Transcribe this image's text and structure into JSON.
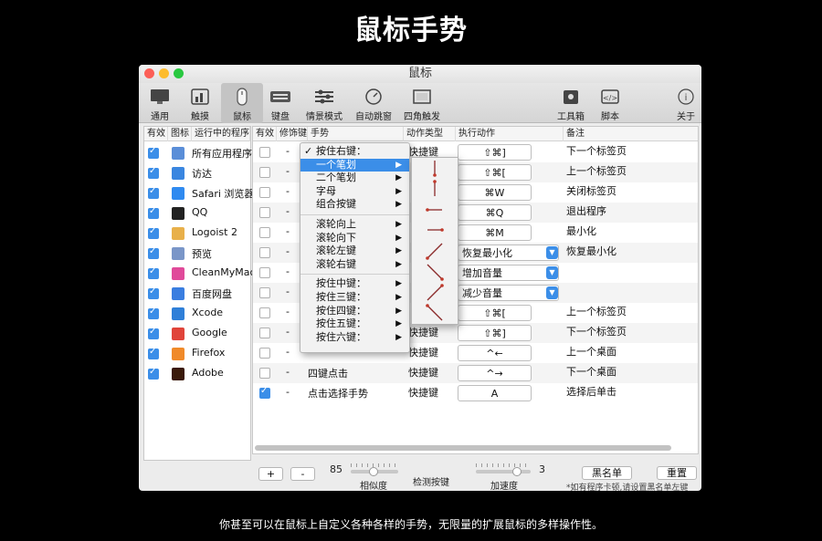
{
  "page_title": "鼠标手势",
  "caption": "你甚至可以在鼠标上自定义各种各样的手势，无限量的扩展鼠标的多样操作性。",
  "window": {
    "title": "鼠标",
    "toolbar": [
      {
        "label": "通用",
        "icon": "display-icon"
      },
      {
        "label": "触摸",
        "icon": "chart-icon"
      },
      {
        "label": "鼠标",
        "icon": "mouse-icon"
      },
      {
        "label": "键盘",
        "icon": "keyboard-icon"
      },
      {
        "label": "情景模式",
        "icon": "sliders-icon"
      },
      {
        "label": "自动跳窗",
        "icon": "speedometer-icon"
      },
      {
        "label": "四角触发",
        "icon": "corners-icon"
      },
      {
        "label": "工具箱",
        "icon": "toolbox-icon"
      },
      {
        "label": "脚本",
        "icon": "script-icon"
      },
      {
        "label": "关于",
        "icon": "info-icon"
      }
    ],
    "left_table": {
      "headers": [
        "有效",
        "图标",
        "运行中的程序"
      ],
      "rows": [
        {
          "name": "所有应用程序",
          "color": "#5a8ed8",
          "checked": true
        },
        {
          "name": "访达",
          "color": "#3a86e0",
          "checked": true
        },
        {
          "name": "Safari 浏览器",
          "color": "#2f8af0",
          "checked": true
        },
        {
          "name": "QQ",
          "color": "#222222",
          "checked": true
        },
        {
          "name": "Logoist 2",
          "color": "#e8b04a",
          "checked": true
        },
        {
          "name": "预览",
          "color": "#7a96c8",
          "checked": true
        },
        {
          "name": "CleanMyMac",
          "color": "#e04a9a",
          "checked": true
        },
        {
          "name": "百度网盘",
          "color": "#3a7ee0",
          "checked": true
        },
        {
          "name": "Xcode",
          "color": "#2f7fd8",
          "checked": true
        },
        {
          "name": "Google",
          "color": "#e0443a",
          "checked": true
        },
        {
          "name": "Firefox",
          "color": "#f08a2a",
          "checked": true
        },
        {
          "name": "Adobe",
          "color": "#3a1a0a",
          "checked": true
        }
      ]
    },
    "right_table": {
      "headers": [
        "有效",
        "修饰键",
        "手势",
        "动作类型",
        "执行动作",
        "备注"
      ],
      "rows": [
        {
          "checked": false,
          "mod": "-",
          "gesture": "",
          "type": "快捷键",
          "action": "⇧⌘]",
          "select": false,
          "note": "下一个标签页"
        },
        {
          "checked": false,
          "mod": "-",
          "gesture": "",
          "type": "",
          "action": "⇧⌘[",
          "select": false,
          "note": "上一个标签页"
        },
        {
          "checked": false,
          "mod": "-",
          "gesture": "",
          "type": "",
          "action": "⌘W",
          "select": false,
          "note": "关闭标签页"
        },
        {
          "checked": false,
          "mod": "-",
          "gesture": "",
          "type": "",
          "action": "⌘Q",
          "select": false,
          "note": "退出程序"
        },
        {
          "checked": false,
          "mod": "-",
          "gesture": "",
          "type": "",
          "action": "⌘M",
          "select": false,
          "note": "最小化"
        },
        {
          "checked": false,
          "mod": "-",
          "gesture": "",
          "type": "",
          "action": "恢复最小化",
          "select": true,
          "note": "恢复最小化"
        },
        {
          "checked": false,
          "mod": "-",
          "gesture": "",
          "type": "",
          "action": "增加音量",
          "select": true,
          "note": ""
        },
        {
          "checked": false,
          "mod": "-",
          "gesture": "",
          "type": "",
          "action": "减少音量",
          "select": true,
          "note": ""
        },
        {
          "checked": false,
          "mod": "-",
          "gesture": "",
          "type": "",
          "action": "⇧⌘[",
          "select": false,
          "note": "上一个标签页"
        },
        {
          "checked": false,
          "mod": "-",
          "gesture": "",
          "type": "快捷键",
          "action": "⇧⌘]",
          "select": false,
          "note": "下一个标签页"
        },
        {
          "checked": false,
          "mod": "-",
          "gesture": "",
          "type": "快捷键",
          "action": "^←",
          "select": false,
          "note": "上一个桌面"
        },
        {
          "checked": false,
          "mod": "-",
          "gesture": "四键点击",
          "type": "快捷键",
          "action": "^→",
          "select": false,
          "note": "下一个桌面"
        },
        {
          "checked": true,
          "mod": "-",
          "gesture": "点击选择手势",
          "type": "快捷键",
          "action": "A",
          "select": false,
          "note": "选择后单击"
        }
      ]
    },
    "context_menu": {
      "items": [
        {
          "label": "按住右键：",
          "checked": true,
          "submenu": false,
          "highlighted": false
        },
        {
          "label": "一个笔划",
          "checked": false,
          "submenu": true,
          "highlighted": true
        },
        {
          "label": "二个笔划",
          "checked": false,
          "submenu": true,
          "highlighted": false
        },
        {
          "label": "字母",
          "checked": false,
          "submenu": true,
          "highlighted": false
        },
        {
          "label": "组合按键",
          "checked": false,
          "submenu": true,
          "highlighted": false
        },
        {
          "label": "滚轮向上",
          "checked": false,
          "submenu": true,
          "highlighted": false
        },
        {
          "label": "滚轮向下",
          "checked": false,
          "submenu": true,
          "highlighted": false
        },
        {
          "label": "滚轮左键",
          "checked": false,
          "submenu": true,
          "highlighted": false
        },
        {
          "label": "滚轮右键",
          "checked": false,
          "submenu": true,
          "highlighted": false
        },
        {
          "label": "按住中键：",
          "checked": false,
          "submenu": true,
          "highlighted": false
        },
        {
          "label": "按住三键：",
          "checked": false,
          "submenu": true,
          "highlighted": false
        },
        {
          "label": "按住四键：",
          "checked": false,
          "submenu": true,
          "highlighted": false
        },
        {
          "label": "按住五键：",
          "checked": false,
          "submenu": true,
          "highlighted": false
        },
        {
          "label": "按住六键：",
          "checked": false,
          "submenu": true,
          "highlighted": false
        }
      ],
      "stroke_directions": [
        "down",
        "up",
        "left",
        "right",
        "down-left",
        "down-right",
        "up-right",
        "up-left"
      ]
    },
    "bottom": {
      "add": "+",
      "remove": "-",
      "similarity_value": "85",
      "similarity_label": "相似度",
      "detect_label": "检测按键",
      "speed_label": "加速度",
      "speed_value": "3",
      "blacklist": "黑名单",
      "reset": "重置",
      "hint": "*如有程序卡顿,请设置黑名单左键"
    }
  }
}
